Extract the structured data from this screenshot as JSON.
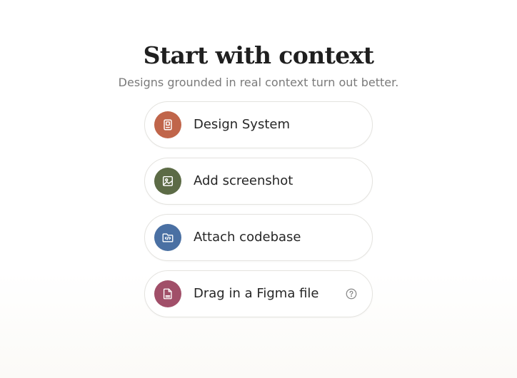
{
  "header": {
    "title": "Start with context",
    "subtitle": "Designs grounded in real context turn out better."
  },
  "options": [
    {
      "label": "Design System",
      "icon": "book-icon",
      "color": "#c0654a"
    },
    {
      "label": "Add screenshot",
      "icon": "image-icon",
      "color": "#5c6b46"
    },
    {
      "label": "Attach codebase",
      "icon": "code-folder-icon",
      "color": "#4a70a3"
    },
    {
      "label": "Drag in a Figma file",
      "icon": "file-icon",
      "color": "#a14f69",
      "help_icon": "help-circle-icon"
    }
  ]
}
